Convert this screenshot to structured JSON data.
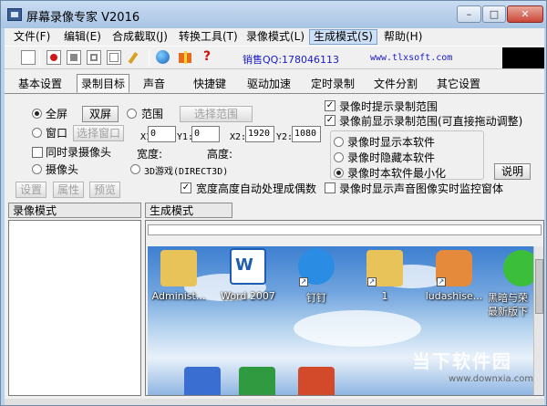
{
  "window": {
    "title": "屏幕录像专家 V2016",
    "accent": "#b9d1ea"
  },
  "menu": [
    {
      "label": "文件(F)"
    },
    {
      "label": "编辑(E)"
    },
    {
      "label": "合成截取(J)"
    },
    {
      "label": "转换工具(T)"
    },
    {
      "label": "录像模式(L)"
    },
    {
      "label": "生成模式(S)"
    },
    {
      "label": "帮助(H)"
    }
  ],
  "toolbar": {
    "sales": "销售QQ:178046113",
    "site": "www.tlxsoft.com",
    "icons": [
      "new-file-icon",
      "record-icon",
      "stop-icon",
      "pause-icon",
      "window-icon",
      "pen-icon",
      "globe-icon",
      "gift-icon",
      "help-icon"
    ]
  },
  "tabs": [
    {
      "label": "基本设置"
    },
    {
      "label": "录制目标"
    },
    {
      "label": "声音"
    },
    {
      "label": "快捷键"
    },
    {
      "label": "驱动加速"
    },
    {
      "label": "定时录制"
    },
    {
      "label": "文件分割"
    },
    {
      "label": "其它设置"
    }
  ],
  "target": {
    "fullscreen": "全屏",
    "dual_screen": "双屏",
    "range": "范围",
    "select_range": "选择范围",
    "window": "窗口",
    "select_window": "选择窗口",
    "camera_sync": "同时录摄像头",
    "camera": "摄像头",
    "x1_label": "X1:",
    "x1_value": "0",
    "y1_label": "Y1:",
    "y1_value": "0",
    "x2_label": "X2:",
    "x2_value": "1920",
    "y2_label": "Y2:",
    "y2_value": "1080",
    "width_label": "宽度:",
    "height_label": "高度:",
    "game_3d": "3D游戏(DIRECT3D)",
    "settings": "设置",
    "properties": "属性",
    "preview": "预览",
    "auto_even": "宽度高度自动处理成偶数"
  },
  "options": {
    "show_range": "录像时提示录制范围",
    "show_range_before": "录像前显示录制范围(可直接拖动调整)",
    "display_software": "录像时显示本软件",
    "hide_software": "录像时隐藏本软件",
    "minimize_software": "录像时本软件最小化",
    "explain": "说明",
    "monitor_window": "录像时显示声音图像实时监控窗体"
  },
  "bottom": {
    "record_mode": "录像模式",
    "generate_mode": "生成模式"
  },
  "desktop": {
    "icons": [
      {
        "label": "Administ...",
        "icon": "user-folder-icon"
      },
      {
        "label": "Word 2007",
        "icon": "word-icon"
      },
      {
        "label": "钉钉",
        "icon": "dingtalk-icon"
      },
      {
        "label": "1",
        "icon": "folder-icon"
      },
      {
        "label": "ludashise...",
        "icon": "ludashi-icon"
      },
      {
        "label": "黑暗与荣",
        "icon": "ie-icon"
      },
      {
        "label": "最新版下",
        "icon": "ie-icon"
      }
    ],
    "watermark": "当下软件园",
    "watermark_url": "www.downxia.com"
  }
}
